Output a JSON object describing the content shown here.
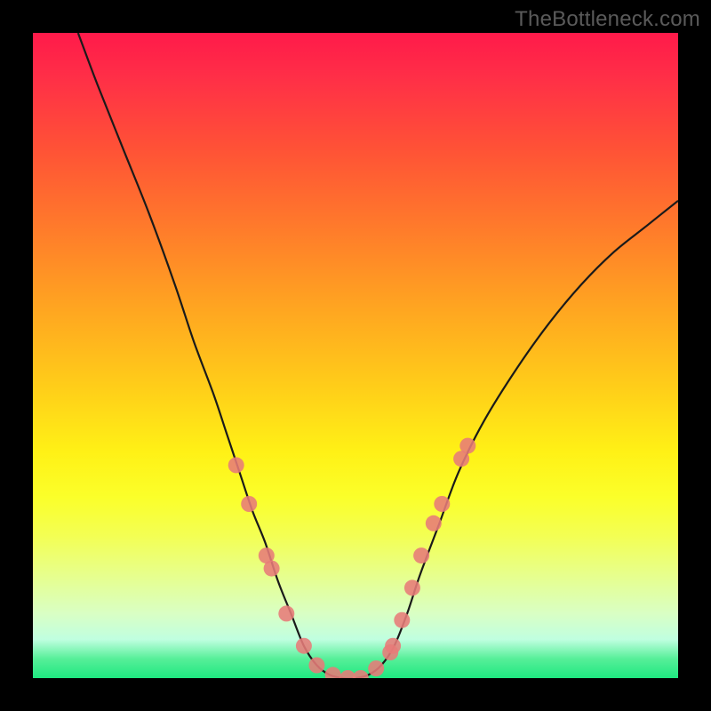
{
  "watermark": "TheBottleneck.com",
  "colors": {
    "frame": "#000000",
    "curve": "#1a1a1a",
    "marker": "#e77b79",
    "gradient_top": "#ff1a4a",
    "gradient_bottom": "#1ee880"
  },
  "chart_data": {
    "type": "line",
    "title": "",
    "xlabel": "",
    "ylabel": "",
    "xlim": [
      0,
      100
    ],
    "ylim": [
      0,
      100
    ],
    "grid": false,
    "legend": false,
    "note": "Values are read as percentages of the plot area. x is horizontal (0=left, 100=right), y is bottleneck-curve height (0=bottom/best match, 100=top/worst).",
    "curve_xy": [
      [
        7,
        100
      ],
      [
        10,
        92
      ],
      [
        14,
        82
      ],
      [
        18,
        72
      ],
      [
        22,
        61
      ],
      [
        25,
        52
      ],
      [
        28,
        44
      ],
      [
        30,
        38
      ],
      [
        32,
        32
      ],
      [
        34,
        26
      ],
      [
        36,
        21
      ],
      [
        38,
        15
      ],
      [
        40,
        10
      ],
      [
        42,
        5
      ],
      [
        44,
        2
      ],
      [
        46,
        0.5
      ],
      [
        48,
        0
      ],
      [
        50,
        0
      ],
      [
        52,
        0.5
      ],
      [
        54,
        2
      ],
      [
        56,
        5
      ],
      [
        58,
        10
      ],
      [
        60,
        16
      ],
      [
        63,
        24
      ],
      [
        66,
        32
      ],
      [
        70,
        40
      ],
      [
        75,
        48
      ],
      [
        80,
        55
      ],
      [
        85,
        61
      ],
      [
        90,
        66
      ],
      [
        95,
        70
      ],
      [
        100,
        74
      ]
    ],
    "markers_xy": [
      [
        31.5,
        33
      ],
      [
        33.5,
        27
      ],
      [
        36.2,
        19
      ],
      [
        37.0,
        17
      ],
      [
        39.3,
        10
      ],
      [
        42.0,
        5
      ],
      [
        44.0,
        2
      ],
      [
        46.5,
        0.5
      ],
      [
        48.8,
        0
      ],
      [
        50.8,
        0
      ],
      [
        53.2,
        1.5
      ],
      [
        55.4,
        4
      ],
      [
        55.8,
        5
      ],
      [
        57.2,
        9
      ],
      [
        58.8,
        14
      ],
      [
        60.2,
        19
      ],
      [
        62.1,
        24
      ],
      [
        63.4,
        27
      ],
      [
        66.4,
        34
      ],
      [
        67.4,
        36
      ]
    ]
  }
}
